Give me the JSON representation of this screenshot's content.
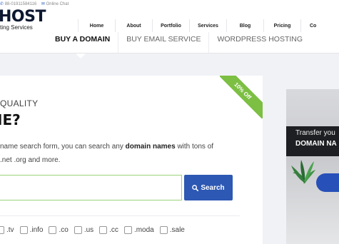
{
  "header": {
    "phone": "88-01911584116",
    "chat": "Online Chat",
    "logo_text": "HOST",
    "tagline": "ting Services"
  },
  "nav": {
    "items": [
      "Home",
      "About",
      "Portfolio",
      "Services",
      "Blog",
      "Pricing",
      "Co"
    ]
  },
  "subtabs": {
    "items": [
      "BUY A DOMAIN",
      "BUY EMAIL SERVICE",
      "WORDPRESS HOSTING"
    ],
    "active_index": 0
  },
  "search_card": {
    "ribbon": "10% Off",
    "eyebrow": "QUALITY",
    "headline": "IE?",
    "desc_part1": "name search form, you can search any ",
    "desc_bold": "domain names",
    "desc_part2": " with tons of",
    "desc_line2": ".net .org and more.",
    "search_value": "",
    "search_button": "Search",
    "tlds": [
      ".tv",
      ".info",
      ".co",
      ".us",
      ".cc",
      ".moda",
      ".sale"
    ]
  },
  "promo": {
    "title": "Transfer you",
    "subtitle": "DOMAIN NA"
  },
  "colors": {
    "accent_blue": "#2d58b3",
    "ribbon_green": "#7cbf42",
    "promo_band": "#1d1f22"
  },
  "icons": {
    "phone": "phone-icon",
    "chat": "chat-icon",
    "search": "search-icon"
  }
}
